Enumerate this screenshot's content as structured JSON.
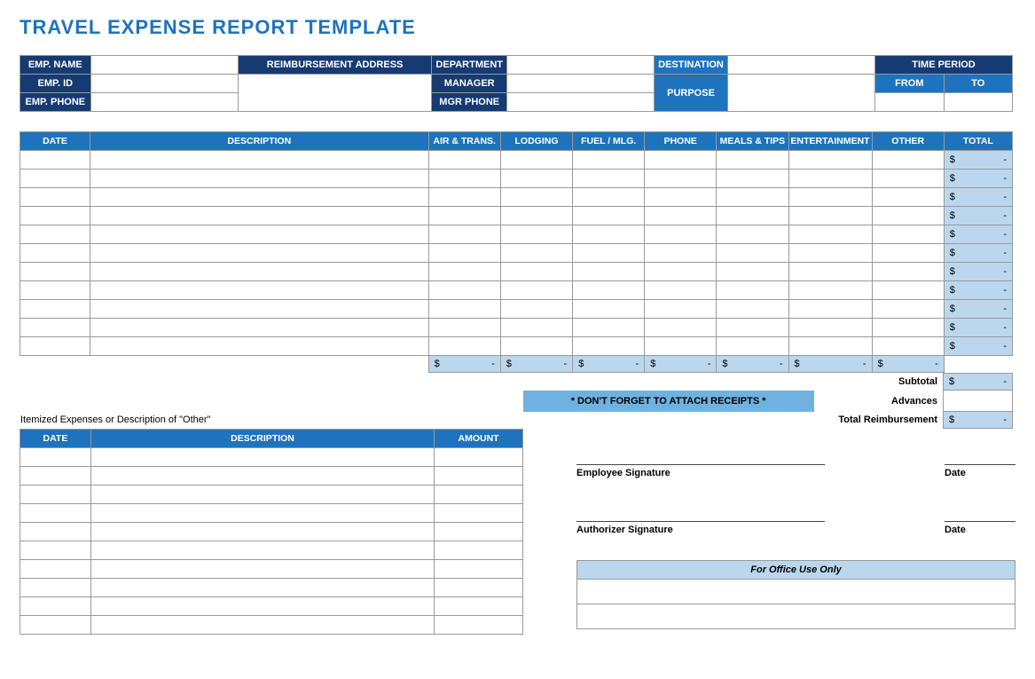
{
  "title": "TRAVEL EXPENSE REPORT TEMPLATE",
  "topLabels": {
    "empName": "EMP. NAME",
    "reimbAddr": "REIMBURSEMENT ADDRESS",
    "department": "DEPARTMENT",
    "destination": "DESTINATION",
    "timePeriod": "TIME PERIOD",
    "empId": "EMP. ID",
    "manager": "MANAGER",
    "purpose": "PURPOSE",
    "from": "FROM",
    "to": "TO",
    "empPhone": "EMP. PHONE",
    "mgrPhone": "MGR PHONE"
  },
  "expenseHeaders": {
    "date": "DATE",
    "description": "DESCRIPTION",
    "air": "AIR & TRANS.",
    "lodging": "LODGING",
    "fuel": "FUEL / MLG.",
    "phone": "PHONE",
    "meals": "MEALS & TIPS",
    "entertainment": "ENTERTAINMENT",
    "other": "OTHER",
    "total": "TOTAL"
  },
  "expenseRowCount": 11,
  "columnSumPlaceholder": {
    "cur": "$",
    "dash": "-"
  },
  "rowTotalPlaceholder": {
    "cur": "$",
    "dash": "-"
  },
  "summary": {
    "subtotalLabel": "Subtotal",
    "subtotal": {
      "cur": "$",
      "dash": "-"
    },
    "advancesLabel": "Advances",
    "totalReimbLabel": "Total Reimbursement",
    "totalReimb": {
      "cur": "$",
      "dash": "-"
    }
  },
  "receiptsNote": "*  DON'T FORGET TO ATTACH RECEIPTS  *",
  "itemized": {
    "caption": "Itemized Expenses or Description of \"Other\"",
    "headers": {
      "date": "DATE",
      "description": "DESCRIPTION",
      "amount": "AMOUNT"
    },
    "rowCount": 10
  },
  "signatures": {
    "employee": "Employee Signature",
    "authorizer": "Authorizer Signature",
    "date": "Date"
  },
  "officeUse": "For Office Use Only"
}
